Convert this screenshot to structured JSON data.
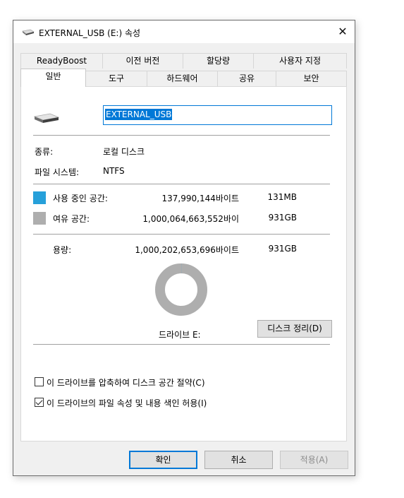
{
  "window": {
    "title": "EXTERNAL_USB (E:) 속성",
    "close_glyph": "✕"
  },
  "tabs": {
    "row1": [
      "ReadyBoost",
      "이전 버전",
      "할당량",
      "사용자 지정"
    ],
    "row2": [
      "일반",
      "도구",
      "하드웨어",
      "공유",
      "보안"
    ],
    "active": "일반"
  },
  "general": {
    "drive_name": "EXTERNAL_USB",
    "type_label": "종류:",
    "type_value": "로컬 디스크",
    "fs_label": "파일 시스템:",
    "fs_value": "NTFS",
    "used": {
      "label": "사용 중인 공간:",
      "bytes": "137,990,144바이트",
      "size": "131MB",
      "color": "#26a0da"
    },
    "free": {
      "label": "여유 공간:",
      "bytes": "1,000,064,663,552바이",
      "size": "931GB",
      "color": "#aeaeae"
    },
    "capacity": {
      "label": "용량:",
      "bytes": "1,000,202,653,696바이트",
      "size": "931GB"
    },
    "used_fraction": 0.000138,
    "drive_label": "드라이브 E:",
    "cleanup_button": "디스크 정리(D)",
    "compress_option": {
      "label": "이 드라이브를 압축하여 디스크 공간 절약(C)",
      "checked": false
    },
    "index_option": {
      "label": "이 드라이브의 파일 속성 및 내용 색인 허용(I)",
      "checked": true
    }
  },
  "buttons": {
    "ok": "확인",
    "cancel": "취소",
    "apply": "적용(A)"
  }
}
